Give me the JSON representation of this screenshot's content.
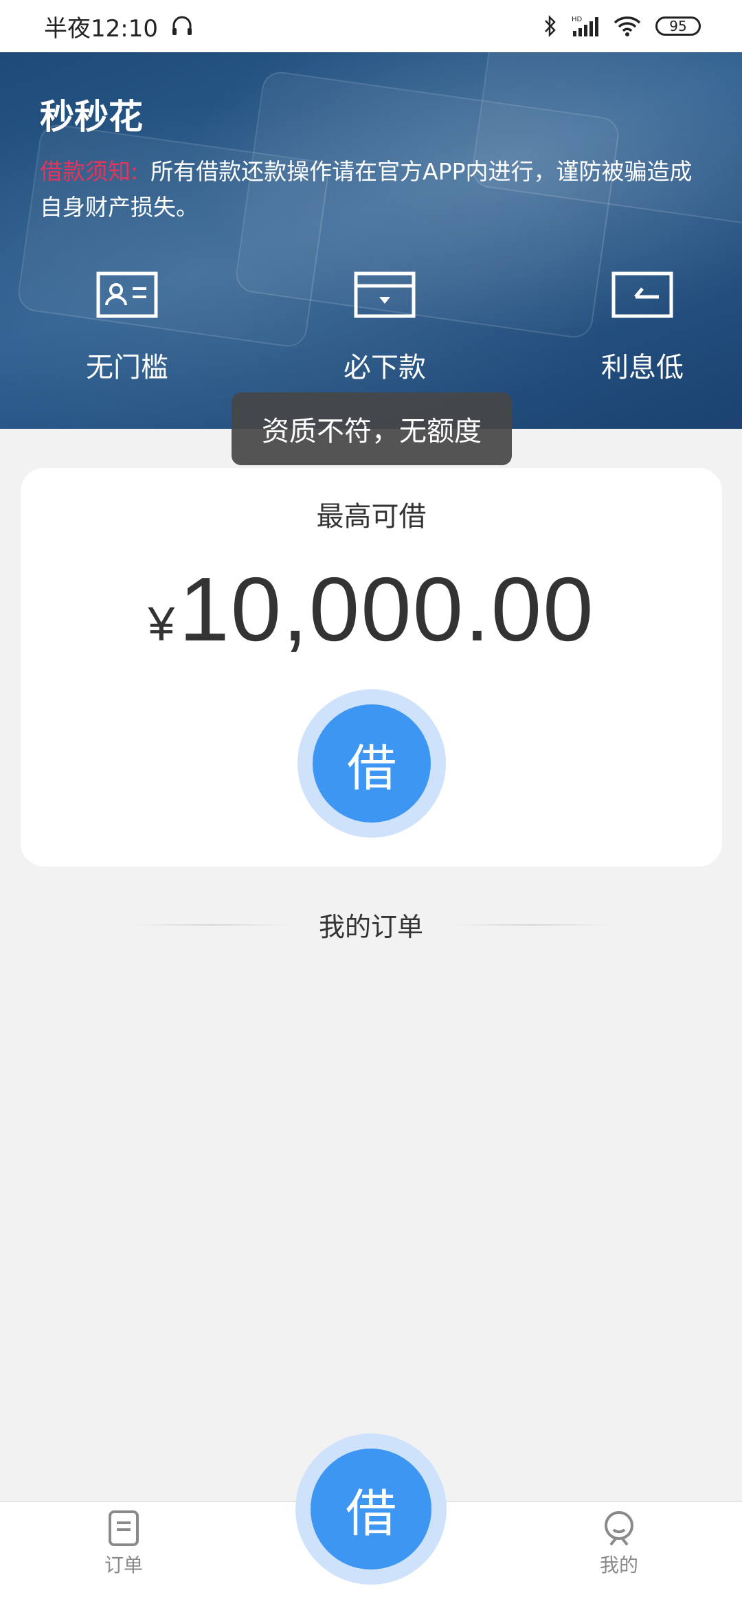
{
  "status_bar": {
    "time": "半夜12:10",
    "battery": "95",
    "icons": [
      "headset-icon",
      "bluetooth-icon",
      "hd-signal-icon",
      "wifi-icon",
      "battery-icon"
    ]
  },
  "banner": {
    "app_title": "秒秒花",
    "notice_label": "借款须知:",
    "notice_text": "所有借款还款操作请在官方APP内进行，谨防被骗造成自身财产损失。",
    "features": [
      {
        "label": "无门槛",
        "icon": "id-card-icon"
      },
      {
        "label": "必下款",
        "icon": "wallet-icon"
      },
      {
        "label": "利息低",
        "icon": "return-card-icon"
      }
    ]
  },
  "toast": {
    "text": "资质不符，无额度"
  },
  "loan_card": {
    "title": "最高可借",
    "currency": "¥",
    "amount": "10,000.00",
    "borrow_button": "借"
  },
  "orders_section": {
    "title": "我的订单"
  },
  "bottom_nav": {
    "items": [
      {
        "label": "订单",
        "icon": "document-icon"
      },
      {
        "label": "我的",
        "icon": "profile-icon"
      }
    ],
    "center_button": "借"
  },
  "colors": {
    "accent_blue": "#3d96f2",
    "accent_light": "#cfe2fb",
    "notice_red": "#e8335a",
    "banner_blue": "#2d5f90"
  }
}
